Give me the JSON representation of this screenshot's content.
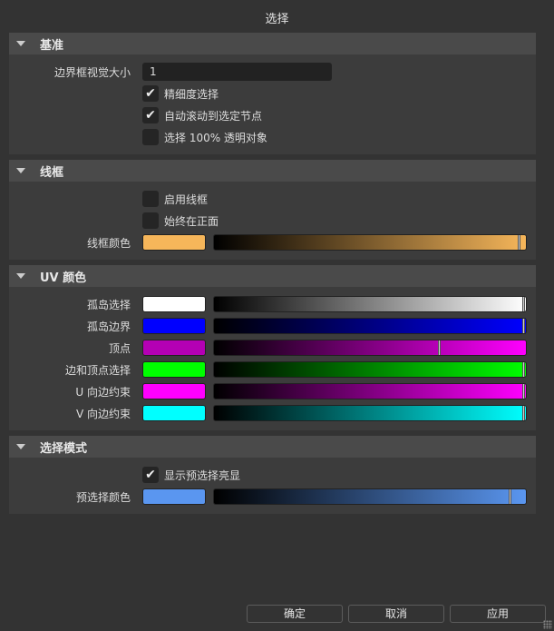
{
  "window_title": "选择",
  "sections": {
    "basic": {
      "title": "基准",
      "bbox_label": "边界框视觉大小",
      "bbox_value": "1",
      "fine_select": {
        "label": "精细度选择",
        "checked": true
      },
      "autoscroll": {
        "label": "自动滚动到选定节点",
        "checked": true
      },
      "transparent": {
        "label": "选择 100% 透明对象",
        "checked": false
      }
    },
    "wireframe": {
      "title": "线框",
      "enable": {
        "label": "启用线框",
        "checked": false
      },
      "on_top": {
        "label": "始终在正面",
        "checked": false
      },
      "color": {
        "label": "线框颜色",
        "hex": "#f6b65a",
        "value": 0.985
      }
    },
    "uv": {
      "title": "UV 颜色",
      "items": [
        {
          "label": "孤岛选择",
          "hex": "#ffffff",
          "full": "#ffffff",
          "value": 1.0
        },
        {
          "label": "孤岛边界",
          "hex": "#0000ff",
          "full": "#0000ff",
          "value": 1.0
        },
        {
          "label": "顶点",
          "hex": "#b400b4",
          "full": "#ff00ff",
          "value": 0.73
        },
        {
          "label": "边和顶点选择",
          "hex": "#00ff00",
          "full": "#00ff00",
          "value": 1.0
        },
        {
          "label": "U 向边约束",
          "hex": "#ff00ff",
          "full": "#ff00ff",
          "value": 1.0
        },
        {
          "label": "V 向边约束",
          "hex": "#00ffff",
          "full": "#00ffff",
          "value": 1.0
        }
      ]
    },
    "mode": {
      "title": "选择模式",
      "highlight": {
        "label": "显示预选择亮显",
        "checked": true
      },
      "color": {
        "label": "预选择颜色",
        "hex": "#5a96f0",
        "value": 0.955
      }
    }
  },
  "buttons": {
    "ok": "确定",
    "cancel": "取消",
    "apply": "应用"
  },
  "check_glyph": "✔"
}
